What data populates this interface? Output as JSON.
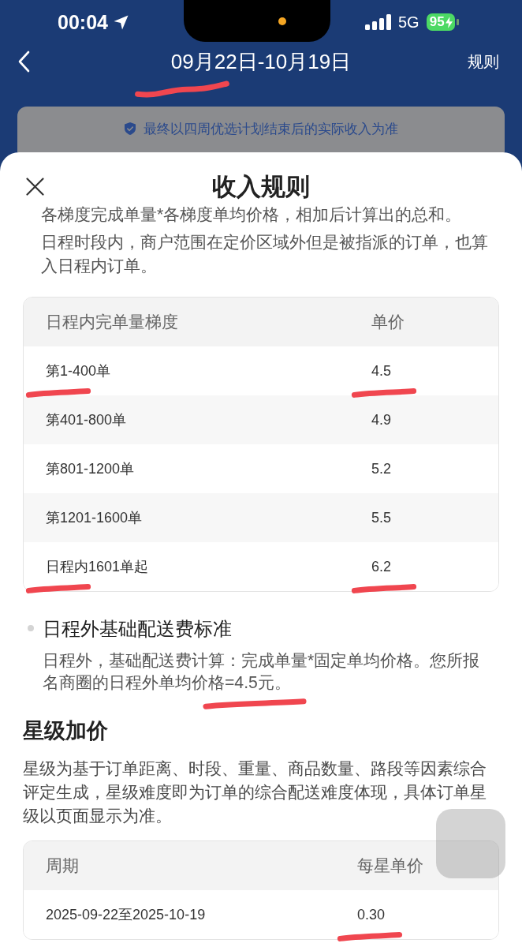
{
  "status_bar": {
    "time": "00:04",
    "network": "5G",
    "battery": "95"
  },
  "nav": {
    "title": {
      "text": "09月22日-10月19日",
      "pen_mark": true
    },
    "action": "规则"
  },
  "notice": "最终以四周优选计划结束后的实际收入为准",
  "sheet": {
    "title": "收入规则",
    "intro": [
      "各梯度完成单量*各梯度单均价格，相加后计算出的总和。",
      "日程时段内，商户范围在定价区域外但是被指派的订单，也算入日程内订单。"
    ],
    "tier_table": {
      "columns": [
        "日程内完单量梯度",
        "单价"
      ],
      "rows": [
        {
          "cells": [
            {
              "text": "第1-400单",
              "pen_mark": true
            },
            {
              "text": "4.5",
              "pen_mark": true
            }
          ]
        },
        {
          "cells": [
            {
              "text": "第401-800单",
              "pen_mark": false
            },
            {
              "text": "4.9",
              "pen_mark": false
            }
          ]
        },
        {
          "cells": [
            {
              "text": "第801-1200单",
              "pen_mark": false
            },
            {
              "text": "5.2",
              "pen_mark": false
            }
          ]
        },
        {
          "cells": [
            {
              "text": "第1201-1600单",
              "pen_mark": false
            },
            {
              "text": "5.5",
              "pen_mark": false
            }
          ]
        },
        {
          "cells": [
            {
              "text": "日程内1601单起",
              "pen_mark": true
            },
            {
              "text": "6.2",
              "pen_mark": true
            }
          ]
        }
      ]
    },
    "offschedule": {
      "title": "日程外基础配送费标准",
      "text": "日程外，基础配送费计算：完成单量*固定单均价格。您所报名商圈的日程外单均价格=4.5元。",
      "pen_mark": true
    },
    "star_pricing": {
      "heading": "星级加价",
      "text": "星级为基于订单距离、时段、重量、商品数量、路段等因素综合评定生成，星级难度即为订单的综合配送难度体现，具体订单星级以页面显示为准。",
      "table": {
        "columns": [
          "周期",
          "每星单价"
        ],
        "rows": [
          {
            "cells": [
              {
                "text": "2025-09-22至2025-10-19",
                "pen_mark": false
              },
              {
                "text": "0.30",
                "pen_mark": true
              }
            ]
          }
        ]
      }
    }
  }
}
